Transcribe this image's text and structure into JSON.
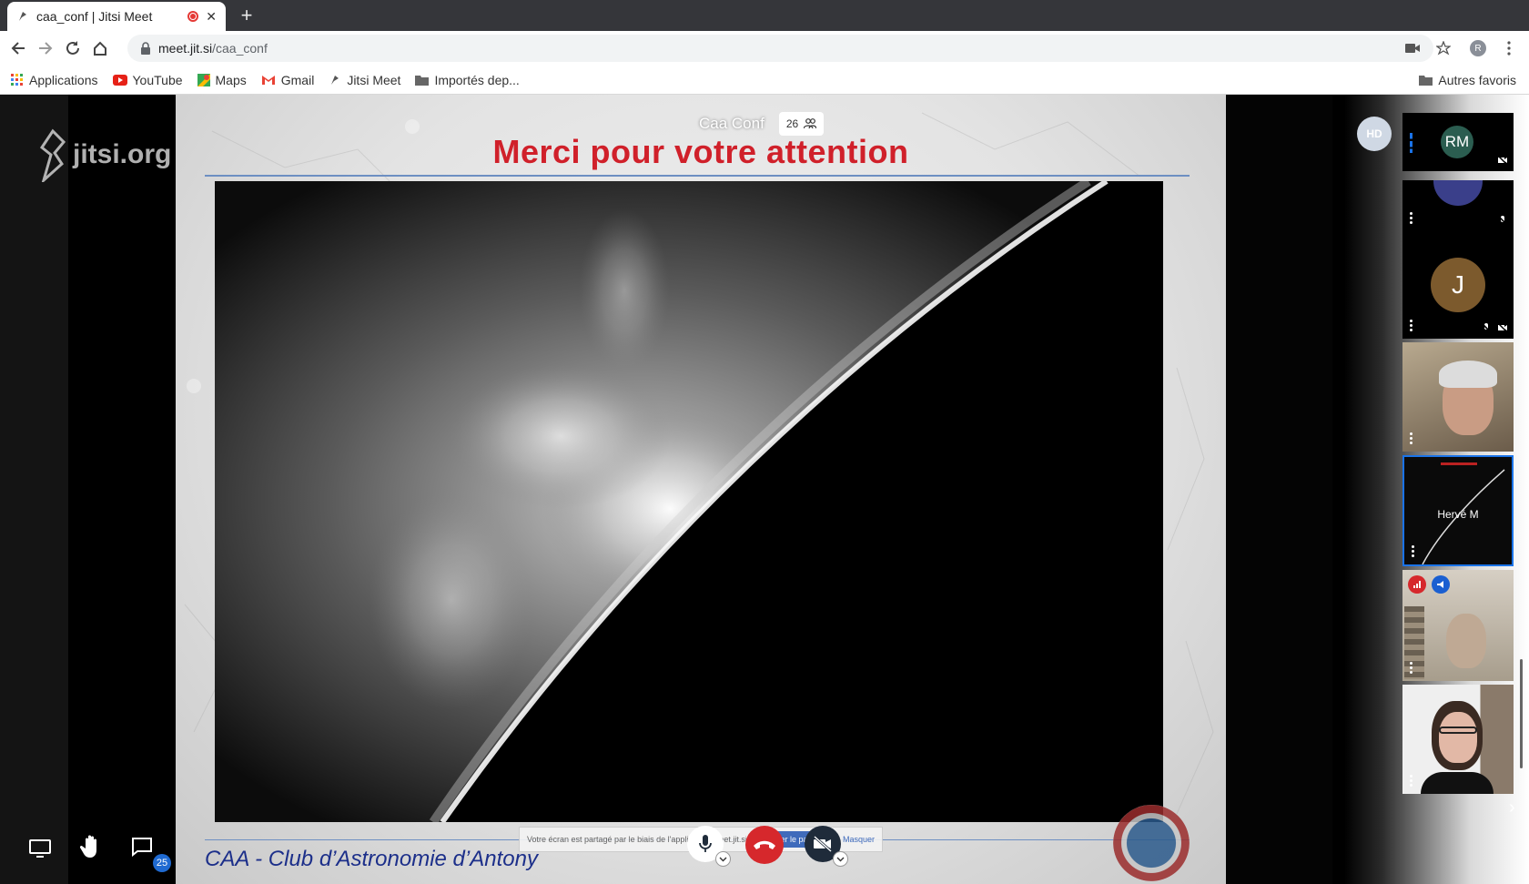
{
  "browser": {
    "tab_title": "caa_conf | Jitsi Meet",
    "url_host": "meet.jit.si",
    "url_path": "/caa_conf",
    "profile_initial": "R",
    "bookmarks": [
      "Applications",
      "YouTube",
      "Maps",
      "Gmail",
      "Jitsi Meet",
      "Importés dep..."
    ],
    "other_bookmarks": "Autres favoris"
  },
  "meeting": {
    "conference_name": "Caa Conf",
    "participant_count": "26",
    "chat_unread": "25",
    "logo_text": "jitsi.org",
    "share_banner": {
      "message": "Votre écran est partagé par le biais de l'application meet.jit.si",
      "stop_label": "Arrêter le partage",
      "hide_label": "Masquer"
    }
  },
  "slide": {
    "title": "Merci pour votre attention",
    "footer": "CAA - Club d’Astronomie d’Antony"
  },
  "filmstrip": {
    "dominant_badge": "HD",
    "tiles": [
      {
        "initials": "RM",
        "color": "#2b5d50"
      },
      {
        "initials": "",
        "color": "#3a3f8a"
      },
      {
        "initials": "J",
        "color": "#7c5a2d"
      },
      {
        "name": ""
      },
      {
        "name": "Hervé M"
      },
      {
        "name": ""
      },
      {
        "name": ""
      }
    ]
  },
  "colors": {
    "accent": "#1a73e8",
    "hangup": "#d6282c",
    "slide_title": "#d0202a",
    "footer_text": "#1c2f8a"
  },
  "icons": [
    "back-icon",
    "forward-icon",
    "reload-icon",
    "home-icon",
    "lock-icon",
    "camera-blocked-icon",
    "star-icon",
    "menu-icon",
    "microphone-icon",
    "hangup-icon",
    "camera-off-icon",
    "share-screen-icon",
    "raise-hand-icon",
    "chat-icon",
    "tile-view-icon",
    "info-icon",
    "more-icon"
  ]
}
